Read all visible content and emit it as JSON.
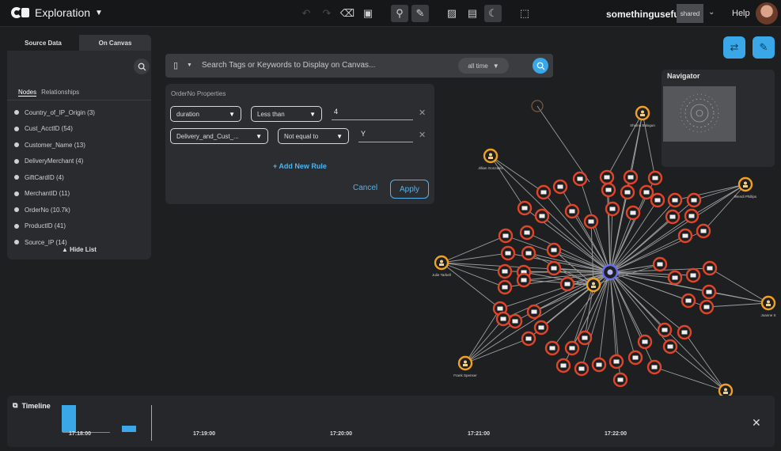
{
  "header": {
    "app_title": "Exploration",
    "user_name": "somethinguseful",
    "shared_badge": "shared",
    "help": "Help",
    "toolbar_icons": [
      "undo-icon",
      "redo-icon",
      "cleanup-icon",
      "layout-icon",
      "search-canvas-icon",
      "style-icon",
      "image-icon",
      "document-icon",
      "dark-mode-icon",
      "export-icon"
    ]
  },
  "left_panel": {
    "tabs": [
      "Source Data",
      "On Canvas"
    ],
    "subtabs": [
      "Nodes",
      "Relationships"
    ],
    "nodes": [
      "Country_of_IP_Origin (3)",
      "Cust_AcctID (54)",
      "Customer_Name (13)",
      "DeliveryMerchant (4)",
      "GiftCardID (4)",
      "MerchantID (11)",
      "OrderNo (10.7k)",
      "ProductID (41)",
      "Source_IP (14)"
    ],
    "hide_list": "▲ Hide List"
  },
  "search": {
    "placeholder": "Search Tags or Keywords to Display on Canvas...",
    "time_filter": "all time"
  },
  "rules": {
    "title": "OrderNo Properties",
    "rows": [
      {
        "field": "duration",
        "operator": "Less than",
        "value": "4"
      },
      {
        "field": "Delivery_and_Cust_...",
        "operator": "Not equal to",
        "value": "Y"
      }
    ],
    "add_rule": "+ Add New Rule",
    "cancel": "Cancel",
    "apply": "Apply"
  },
  "navigator": {
    "title": "Navigator"
  },
  "graph_labels": {
    "top": "Shiona Balogun",
    "top_left": "Jillian Gonzalez",
    "left": "Julie Tarbell",
    "right_top": "Wendi Phillips",
    "right": "Joanne S",
    "bottom_left": "Frank Spenser"
  },
  "timeline": {
    "title": "Timeline",
    "ticks": [
      "17:18:00",
      "17:19:00",
      "17:20:00",
      "17:21:00",
      "17:22:00"
    ],
    "bars": [
      {
        "label": "bar-1",
        "level": 0.85
      },
      {
        "label": "bar-2",
        "level": 0.2
      }
    ]
  },
  "colors": {
    "accent": "#3aa8e8",
    "order_node": "#e0452a",
    "customer_node": "#f0a020",
    "hub_node": "#6a6cf0"
  }
}
